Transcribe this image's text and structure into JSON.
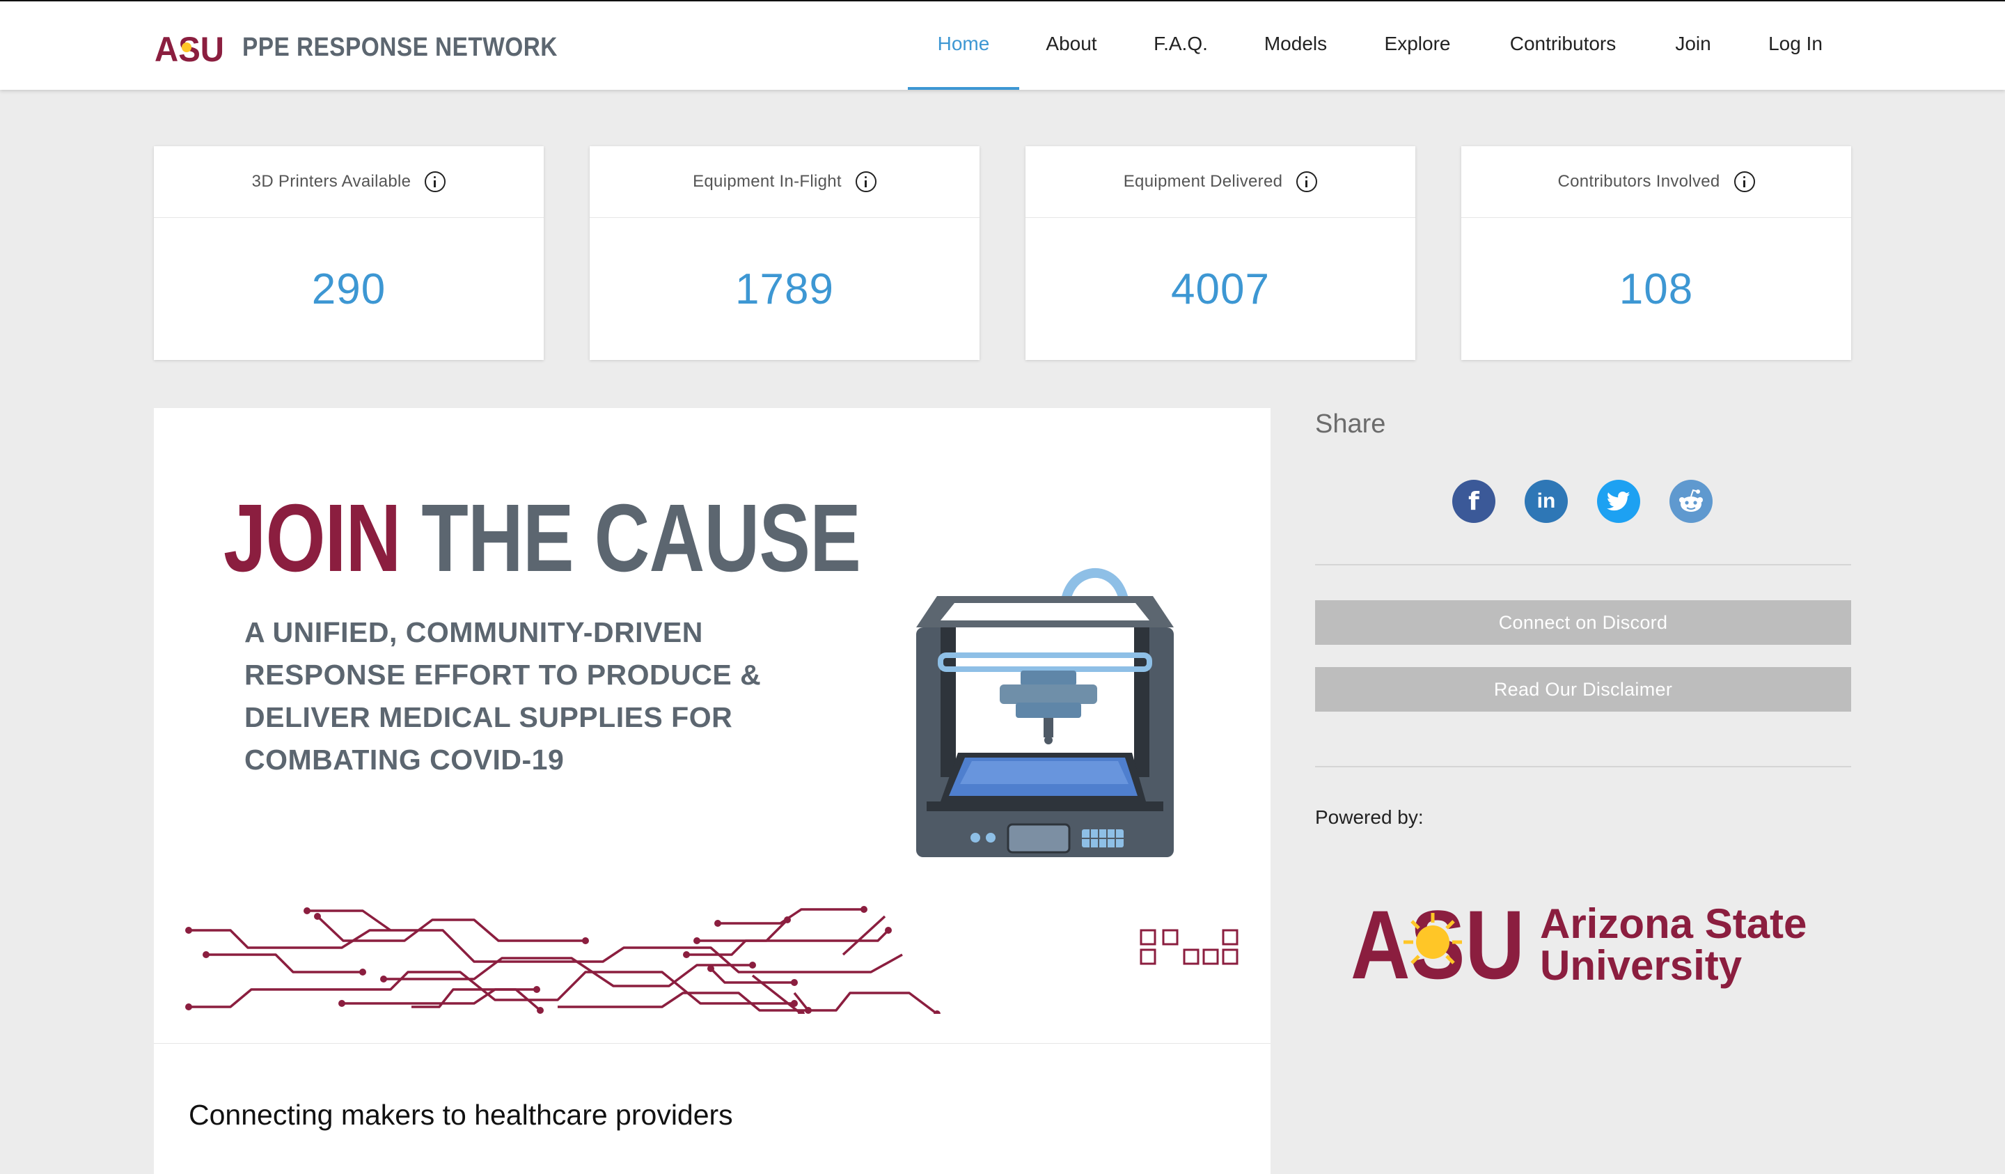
{
  "header": {
    "brand_mark_text": "ASU",
    "brand_text": "PPE RESPONSE NETWORK",
    "nav": [
      {
        "label": "Home",
        "active": true
      },
      {
        "label": "About"
      },
      {
        "label": "F.A.Q."
      },
      {
        "label": "Models"
      },
      {
        "label": "Explore"
      },
      {
        "label": "Contributors"
      },
      {
        "label": "Join"
      },
      {
        "label": "Log In"
      }
    ]
  },
  "stats": [
    {
      "label": "3D Printers Available",
      "value": "290"
    },
    {
      "label": "Equipment In-Flight",
      "value": "1789"
    },
    {
      "label": "Equipment Delivered",
      "value": "4007"
    },
    {
      "label": "Contributors Involved",
      "value": "108"
    }
  ],
  "banner": {
    "title_word1": "JOIN",
    "title_word2": "THE CAUSE",
    "tagline": [
      "A UNIFIED, COMMUNITY-DRIVEN",
      "RESPONSE EFFORT TO PRODUCE &",
      "DELIVER MEDICAL SUPPLIES FOR",
      "COMBATING COVID-19"
    ],
    "subtitle": "Connecting makers to healthcare providers"
  },
  "share": {
    "title": "Share",
    "networks": [
      {
        "name": "facebook",
        "icon": "facebook-icon",
        "glyph": "f",
        "color": "#3b5998"
      },
      {
        "name": "linkedin",
        "icon": "linkedin-icon",
        "glyph": "in",
        "color": "#2e77b6"
      },
      {
        "name": "twitter",
        "icon": "twitter-icon",
        "glyph": "",
        "color": "#1da1f2"
      },
      {
        "name": "reddit",
        "icon": "reddit-icon",
        "glyph": "",
        "color": "#5f99cf"
      }
    ],
    "discord_button": "Connect on Discord",
    "disclaimer_button": "Read Our Disclaimer",
    "powered_by": "Powered by:",
    "asu_logo": {
      "mark": "ASU",
      "line1": "Arizona State",
      "line2": "University"
    }
  },
  "colors": {
    "accent": "#3d97d3",
    "asu_maroon": "#8b1e3f",
    "asu_gold": "#ffc627",
    "slate": "#5c6670",
    "button_gray": "#bdbdbd"
  }
}
